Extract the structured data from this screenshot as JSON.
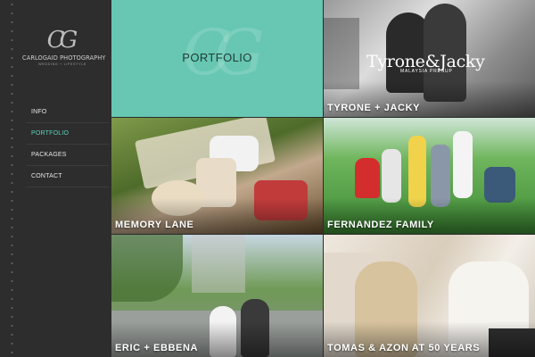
{
  "brand": {
    "monogram": "CG",
    "name": "CARLOGAID PHOTOGRAPHY",
    "tagline": "WEDDING + LIFESTYLE"
  },
  "nav": {
    "items": [
      {
        "label": "INFO"
      },
      {
        "label": "PORTFOLIO"
      },
      {
        "label": "PACKAGES"
      },
      {
        "label": "CONTACT"
      }
    ]
  },
  "portfolio": {
    "title": "PORTFOLIO",
    "watermark": "CG"
  },
  "tiles": [
    {
      "caption": "TYRONE + JACKY",
      "overlay_title": "Tyrone&Jacky",
      "overlay_subtitle": "MALAYSIA PRENUP"
    },
    {
      "caption": "MEMORY LANE"
    },
    {
      "caption": "FERNANDEZ FAMILY"
    },
    {
      "caption": "ERIC + EBBENA"
    },
    {
      "caption": "TOMAS & AZON AT 50 YEARS"
    }
  ],
  "colors": {
    "accent": "#5fd1bb",
    "portfolio_bg": "#67c7b3",
    "sidebar_bg": "#2d2d2d"
  }
}
